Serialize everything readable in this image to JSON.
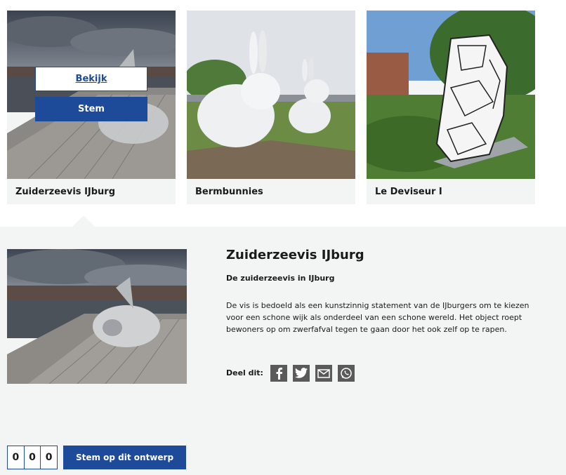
{
  "cards": [
    {
      "title": "Zuiderzeevis IJburg",
      "bekijk_label": "Bekijk",
      "stem_label": "Stem"
    },
    {
      "title": "Bermbunnies"
    },
    {
      "title": "Le Deviseur I"
    }
  ],
  "detail": {
    "title": "Zuiderzeevis IJburg",
    "subtitle": "De zuiderzeevis in IJburg",
    "body": "De vis is bedoeld als een kunstzinnig statement van de IJburgers om te kiezen voor een schone wijk als onderdeel van een schone wereld. Het object roept bewoners op om zwerfafval tegen te gaan door het ook zelf op te rapen.",
    "share_label": "Deel dit:",
    "share_icons": [
      "facebook-icon",
      "twitter-icon",
      "mail-icon",
      "whatsapp-icon"
    ]
  },
  "vote": {
    "digits": [
      "0",
      "0",
      "0"
    ],
    "button_label": "Stem op dit ontwerp"
  },
  "colors": {
    "accent": "#1d4b99",
    "panel_bg": "#f3f5f4",
    "share_icon_bg": "#5a5a5a"
  }
}
